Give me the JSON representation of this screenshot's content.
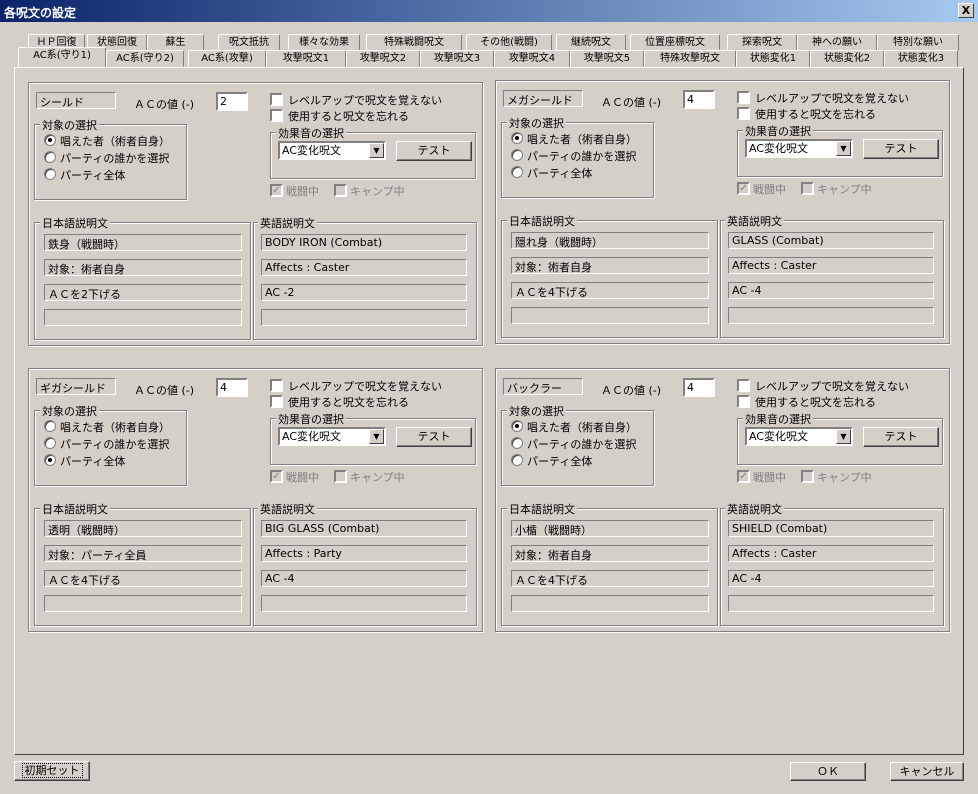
{
  "window": {
    "title": "各呪文の設定",
    "close": "X"
  },
  "tabs_row1": [
    "ＨＰ回復",
    "状態回復",
    "蘇生",
    "呪文抵抗",
    "様々な効果",
    "特殊戦闘呪文",
    "その他(戦闘)",
    "継続呪文",
    "位置座標呪文",
    "探索呪文",
    "神への願い",
    "特別な願い"
  ],
  "tabs_row2": [
    "AC系(守り1)",
    "AC系(守り2)",
    "AC系(攻撃)",
    "攻撃呪文1",
    "攻撃呪文2",
    "攻撃呪文3",
    "攻撃呪文4",
    "攻撃呪文5",
    "特殊攻撃呪文",
    "状態変化1",
    "状態変化2",
    "状態変化3"
  ],
  "common": {
    "ac_label": "ＡＣの値 (-)",
    "levelup_label": "レベルアップで呪文を覚えない",
    "forget_label": "使用すると呪文を忘れる",
    "target_group": "対象の選択",
    "target_options": [
      "唱えた者（術者自身）",
      "パーティの誰かを選択",
      "パーティ全体"
    ],
    "sound_group": "効果音の選択",
    "sound_value": "AC変化呪文",
    "test_label": "テスト",
    "battle_label": "戦闘中",
    "camp_label": "キャンプ中",
    "jp_group": "日本語説明文",
    "en_group": "英語説明文"
  },
  "spells": [
    {
      "name": "シールド",
      "ac": "2",
      "target": 0,
      "jp": [
        "鉄身（戦闘時）",
        "対象：術者自身",
        "ＡＣを2下げる",
        ""
      ],
      "en": [
        "BODY IRON (Combat)",
        "Affects : Caster",
        "AC -2",
        ""
      ]
    },
    {
      "name": "メガシールド",
      "ac": "4",
      "target": 0,
      "jp": [
        "隠れ身（戦闘時）",
        "対象：術者自身",
        "ＡＣを4下げる",
        ""
      ],
      "en": [
        "GLASS (Combat)",
        "Affects : Caster",
        "AC -4",
        ""
      ]
    },
    {
      "name": "ギガシールド",
      "ac": "4",
      "target": 2,
      "jp": [
        "透明（戦闘時）",
        "対象：パーティ全員",
        "ＡＣを4下げる",
        ""
      ],
      "en": [
        "BIG GLASS (Combat)",
        "Affects : Party",
        "AC -4",
        ""
      ]
    },
    {
      "name": "バックラー",
      "ac": "4",
      "target": 0,
      "jp": [
        "小楯（戦闘時）",
        "対象：術者自身",
        "ＡＣを4下げる",
        ""
      ],
      "en": [
        "SHIELD (Combat)",
        "Affects : Caster",
        "AC -4",
        ""
      ]
    }
  ],
  "footer": {
    "initial": "初期セット",
    "ok": "ＯＫ",
    "cancel": "キャンセル"
  }
}
